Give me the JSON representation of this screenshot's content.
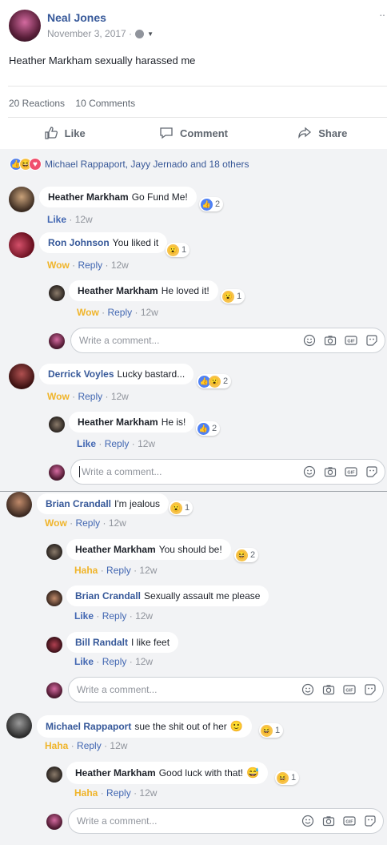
{
  "post": {
    "author": "Neal Jones",
    "date": "November 3, 2017 ·",
    "text": "Heather Markham sexually harassed me",
    "reactions": "20 Reactions",
    "comments": "10 Comments",
    "like_label": "Like",
    "comment_label": "Comment",
    "share_label": "Share",
    "reactors": "Michael Rappaport, Jayy Jernado and 18 others"
  },
  "comments": [
    {
      "name": "Heather Markham",
      "text": "Go Fund Me!",
      "count": "2",
      "action": "Like",
      "time": "· 12w"
    },
    {
      "name": "Ron Johnson",
      "text": "You liked it",
      "count": "1",
      "action": "Wow",
      "reply": "Reply",
      "time": "· 12w"
    },
    {
      "name": "Heather Markham",
      "text": "He loved it!",
      "count": "1",
      "action": "Wow",
      "reply": "Reply",
      "time": "· 12w"
    },
    {
      "name": "Derrick Voyles",
      "text": "Lucky bastard...",
      "count": "2",
      "action": "Wow",
      "reply": "Reply",
      "time": "· 12w"
    },
    {
      "name": "Heather Markham",
      "text": "He is!",
      "count": "2",
      "action": "Like",
      "reply": "Reply",
      "time": "· 12w"
    },
    {
      "name": "Brian Crandall",
      "text": "I'm jealous",
      "count": "1",
      "action": "Wow",
      "reply": "Reply",
      "time": "· 12w"
    },
    {
      "name": "Heather Markham",
      "text": "You should be!",
      "count": "2",
      "action": "Haha",
      "reply": "Reply",
      "time": "· 12w"
    },
    {
      "name": "Brian Crandall",
      "text": "Sexually assault me please",
      "action": "Like",
      "reply": "Reply",
      "time": "· 12w"
    },
    {
      "name": "Bill Randalt",
      "text": "I like feet",
      "action": "Like",
      "reply": "Reply",
      "time": "· 12w"
    },
    {
      "name": "Michael Rappaport",
      "text": "sue the shit out of her",
      "count": "1",
      "action": "Haha",
      "reply": "Reply",
      "time": "· 12w"
    },
    {
      "name": "Heather Markham",
      "text": "Good luck with that!",
      "count": "1",
      "action": "Haha",
      "reply": "Reply",
      "time": "· 12w"
    }
  ],
  "write_placeholder": "Write a comment...",
  "colors": {
    "brand": "#365899",
    "link": "#4267b2",
    "wow": "#f0b429",
    "bg": "#f2f3f5"
  }
}
